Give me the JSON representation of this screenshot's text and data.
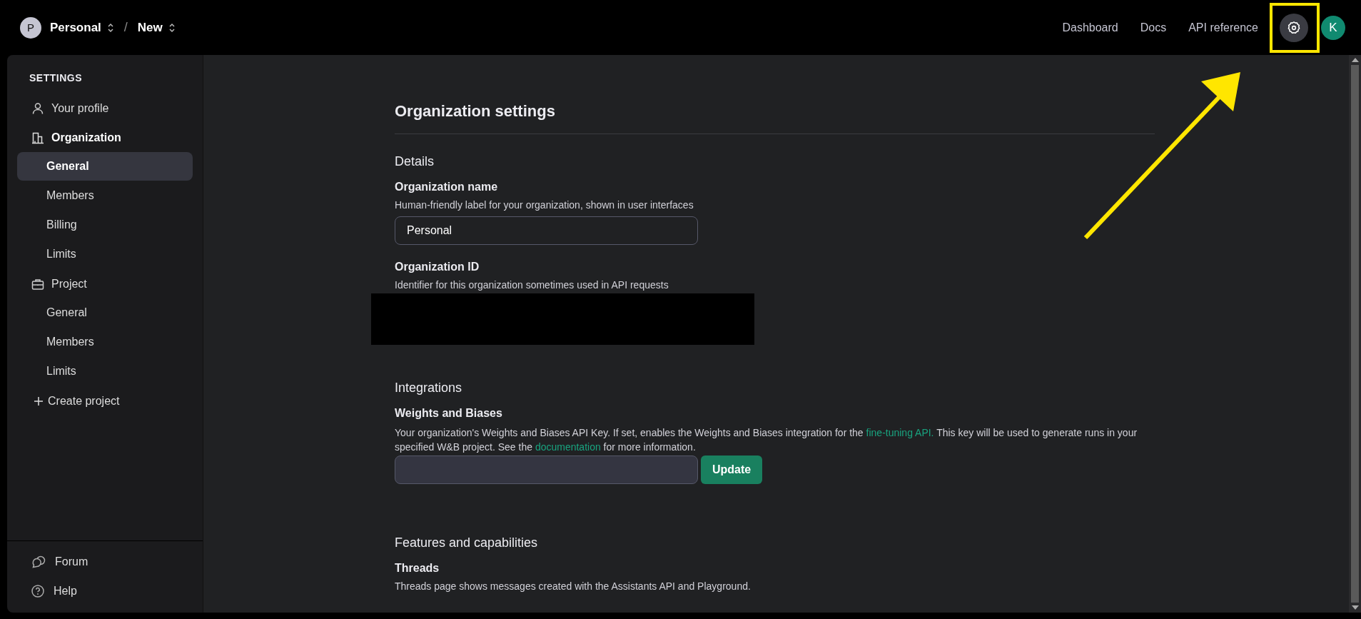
{
  "topbar": {
    "org": {
      "initial": "P",
      "name": "Personal"
    },
    "separator": "/",
    "project": "New",
    "nav": [
      "Dashboard",
      "Docs",
      "API reference"
    ],
    "avatar": "K"
  },
  "sidebar": {
    "heading": "SETTINGS",
    "sections": [
      {
        "kind": "profile",
        "label": "Your profile",
        "active": false
      },
      {
        "kind": "organization",
        "label": "Organization",
        "active": true,
        "children": [
          {
            "label": "General",
            "selected": true
          },
          {
            "label": "Members",
            "selected": false
          },
          {
            "label": "Billing",
            "selected": false
          },
          {
            "label": "Limits",
            "selected": false
          }
        ]
      },
      {
        "kind": "project",
        "label": "Project",
        "active": false,
        "children": [
          {
            "label": "General",
            "selected": false
          },
          {
            "label": "Members",
            "selected": false
          },
          {
            "label": "Limits",
            "selected": false
          }
        ]
      }
    ],
    "create": "Create project",
    "footer": [
      {
        "kind": "forum",
        "label": "Forum"
      },
      {
        "kind": "help",
        "label": "Help"
      }
    ]
  },
  "main": {
    "title": "Organization settings",
    "details": {
      "heading": "Details",
      "name_label": "Organization name",
      "name_hint": "Human-friendly label for your organization, shown in user interfaces",
      "name_value": "Personal",
      "id_label": "Organization ID",
      "id_hint": "Identifier for this organization sometimes used in API requests"
    },
    "integrations": {
      "heading": "Integrations",
      "label": "Weights and Biases",
      "text_1": "Your organization's Weights and Biases API Key. If set, enables the Weights and Biases integration for the",
      "link_1": "fine-tuning API.",
      "text_2": "This key will be used to generate runs in your specified W&B project. See the",
      "link_2": "documentation",
      "text_3": "for more information.",
      "button": "Update"
    },
    "features": {
      "heading": "Features and capabilities",
      "label": "Threads",
      "hint": "Threads page shows messages created with the Assistants API and Playground."
    }
  }
}
